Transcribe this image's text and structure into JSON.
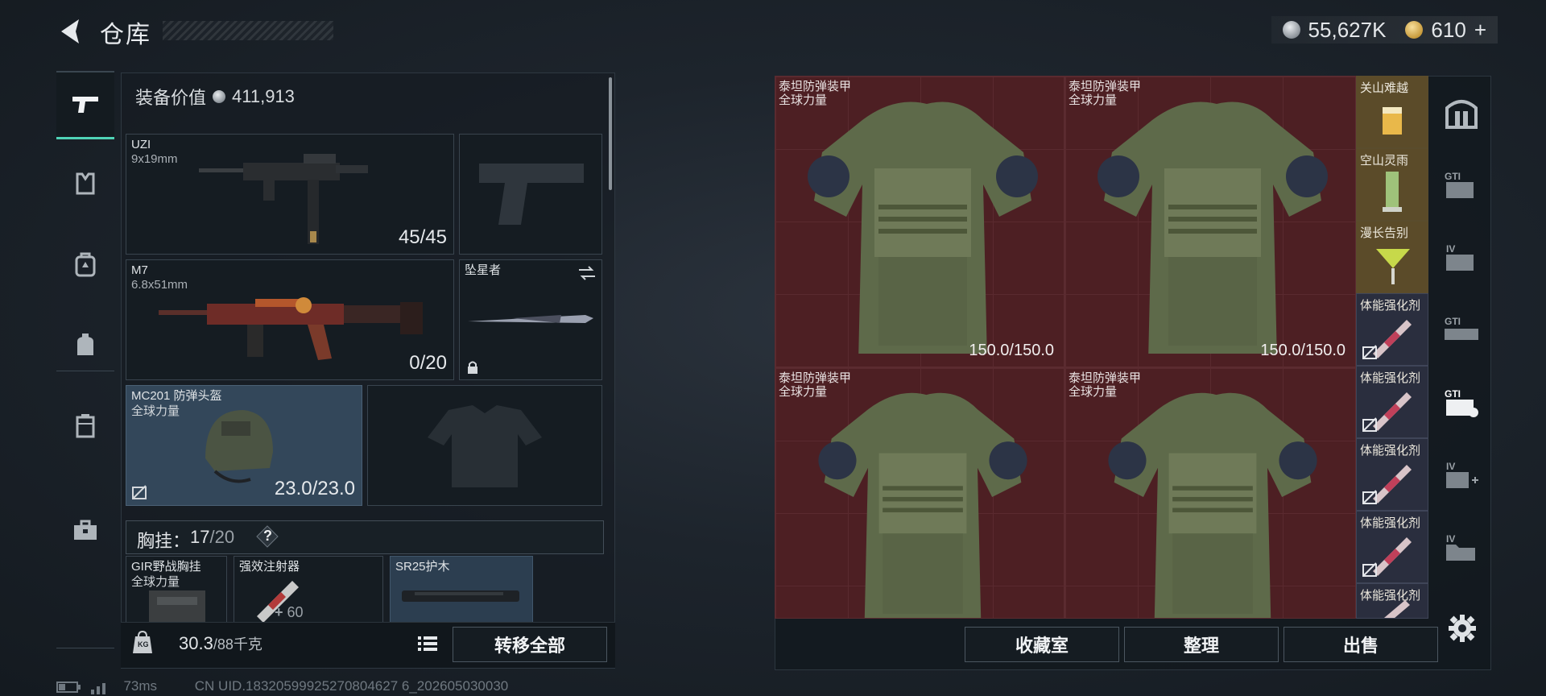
{
  "header": {
    "title": "仓库",
    "currency_silver": "55,627K",
    "currency_gold": "610",
    "currency_add": "+"
  },
  "left_rail": {
    "items": [
      "pistol-icon",
      "armor-icon",
      "backpack-icon",
      "bag-icon",
      "case-icon",
      "toolbox-icon"
    ]
  },
  "loadout": {
    "gear_value_label": "装备价值",
    "gear_value": "411,913",
    "primary": {
      "name": "UZI",
      "caliber": "9x19mm",
      "ammo": "45/45"
    },
    "primary2": {
      "name": "M7",
      "caliber": "6.8x51mm",
      "ammo": "0/20"
    },
    "melee": {
      "name": "坠星者"
    },
    "helmet": {
      "name": "MC201 防弹头盔",
      "sub": "全球力量",
      "durability": "23.0/23.0"
    },
    "rig": {
      "label": "胸挂：",
      "used": "17",
      "max": "20",
      "help": "?"
    },
    "rig_items": [
      {
        "name": "GIR野战胸挂",
        "sub": "全球力量"
      },
      {
        "name": "强效注射器",
        "sub": "",
        "qty": "60"
      },
      {
        "name": "SR25护木",
        "sub": ""
      }
    ],
    "weight_current": "30.3",
    "weight_max": "/88千克",
    "weight_unit_icon": "KG",
    "transfer_all": "转移全部"
  },
  "status": {
    "ping": "73ms",
    "uid": "CN UID.18320599925270804627 6_202605030030"
  },
  "storage": {
    "armors": [
      {
        "name": "泰坦防弹装甲",
        "sub": "全球力量",
        "durability": "150.0/150.0"
      },
      {
        "name": "泰坦防弹装甲",
        "sub": "全球力量",
        "durability": "150.0/150.0"
      },
      {
        "name": "泰坦防弹装甲",
        "sub": "全球力量",
        "durability": ""
      },
      {
        "name": "泰坦防弹装甲",
        "sub": "全球力量",
        "durability": ""
      }
    ],
    "side_items": [
      "关山难越",
      "空山灵雨",
      "漫长告别",
      "体能强化剂",
      "体能强化剂",
      "体能强化剂",
      "体能强化剂",
      "体能强化剂"
    ],
    "buttons": {
      "collection": "收藏室",
      "sort": "整理",
      "sell": "出售"
    }
  },
  "right_rail": {
    "items": [
      "vault-icon",
      "gti-case-icon",
      "iv-case-icon",
      "gti-gun-case-icon",
      "gti-case-selected-icon",
      "iv-case-add-icon",
      "iv-folder-icon"
    ]
  },
  "colors": {
    "accent": "#4fd3b6",
    "armor_bg": "#4d1f23",
    "drink_bg": "#5b4b29",
    "stim_bg": "#2a2e3e"
  }
}
